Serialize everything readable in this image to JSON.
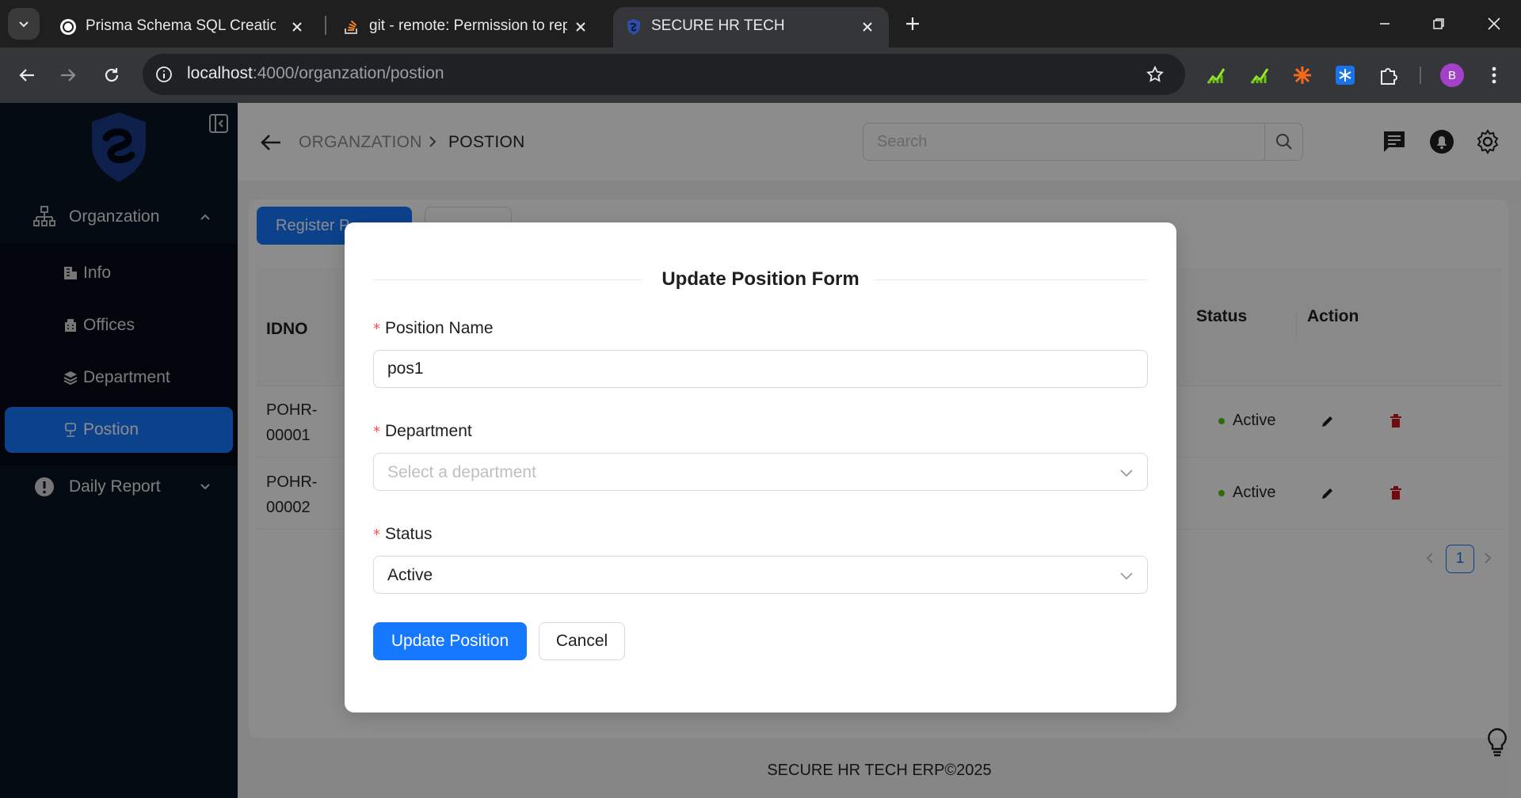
{
  "browser": {
    "tabs": [
      {
        "title": "Prisma Schema SQL Creation",
        "icon": "chatgpt-icon"
      },
      {
        "title": "git - remote: Permission to repo",
        "icon": "stackoverflow-icon"
      },
      {
        "title": "SECURE HR TECH",
        "icon": "shield-logo-icon"
      }
    ],
    "url_host": "localhost",
    "url_path": ":4000/organzation/postion",
    "profile_initial": "B"
  },
  "sidebar": {
    "groups": [
      {
        "label": "Organzation",
        "icon": "organization-icon",
        "expanded": true
      },
      {
        "label": "Daily Report",
        "icon": "alert-circle-icon",
        "expanded": false
      }
    ],
    "items": [
      {
        "label": "Info",
        "icon": "building-icon"
      },
      {
        "label": "Offices",
        "icon": "office-icon"
      },
      {
        "label": "Department",
        "icon": "layers-icon"
      },
      {
        "label": "Postion",
        "icon": "position-icon",
        "selected": true
      }
    ]
  },
  "header": {
    "breadcrumb": [
      "ORGANZATION",
      "POSTION"
    ],
    "search_placeholder": "Search"
  },
  "page": {
    "register_button": "Register P",
    "second_button": "",
    "table": {
      "headers": {
        "id": "IDNO",
        "status": "Status",
        "action": "Action"
      },
      "rows": [
        {
          "id": "POHR-\n00001",
          "status": "Active"
        },
        {
          "id": "POHR-\n00002",
          "status": "Active"
        }
      ]
    },
    "pagination": {
      "current": "1"
    },
    "footer": "SECURE HR TECH ERP©2025"
  },
  "modal": {
    "title": "Update Position Form",
    "fields": {
      "position_name": {
        "label": "Position Name",
        "value": "pos1"
      },
      "department": {
        "label": "Department",
        "placeholder": "Select a department"
      },
      "status": {
        "label": "Status",
        "value": "Active"
      }
    },
    "submit": "Update Position",
    "cancel": "Cancel"
  },
  "colors": {
    "primary": "#1677ff",
    "sidebar": "#081421",
    "danger": "#cf1322",
    "success": "#52c41a"
  }
}
